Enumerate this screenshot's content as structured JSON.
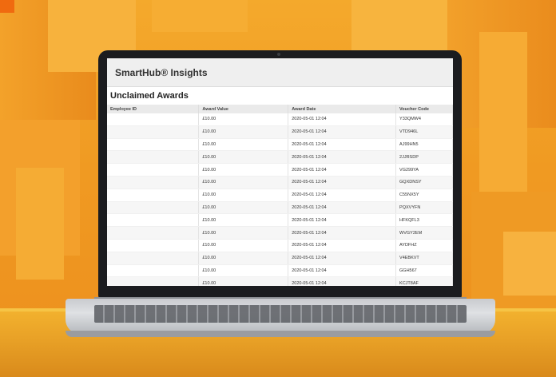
{
  "app": {
    "title": "SmartHub® Insights"
  },
  "section": {
    "title": "Unclaimed Awards"
  },
  "table": {
    "columns": [
      "Employee ID",
      "Award Value",
      "Award Date",
      "Voucher Code"
    ],
    "rows": [
      {
        "employee_id": "",
        "award_value": "£10.00",
        "award_date": "2020-05-01 12:04",
        "voucher_code": "Y33QMW4"
      },
      {
        "employee_id": "",
        "award_value": "£10.00",
        "award_date": "2020-05-01 12:04",
        "voucher_code": "VTD946L"
      },
      {
        "employee_id": "",
        "award_value": "£10.00",
        "award_date": "2020-05-01 12:04",
        "voucher_code": "AJ99HN5"
      },
      {
        "employee_id": "",
        "award_value": "£10.00",
        "award_date": "2020-05-01 12:04",
        "voucher_code": "2JJRSDP"
      },
      {
        "employee_id": "",
        "award_value": "£10.00",
        "award_date": "2020-05-01 12:04",
        "voucher_code": "VG299YA"
      },
      {
        "employee_id": "",
        "award_value": "£10.00",
        "award_date": "2020-05-01 12:04",
        "voucher_code": "GQXDNSY"
      },
      {
        "employee_id": "",
        "award_value": "£10.00",
        "award_date": "2020-05-01 12:04",
        "voucher_code": "C55NX5Y"
      },
      {
        "employee_id": "",
        "award_value": "£10.00",
        "award_date": "2020-05-01 12:04",
        "voucher_code": "PQXVYFN"
      },
      {
        "employee_id": "",
        "award_value": "£10.00",
        "award_date": "2020-05-01 12:04",
        "voucher_code": "HFKQFL3"
      },
      {
        "employee_id": "",
        "award_value": "£10.00",
        "award_date": "2020-05-01 12:04",
        "voucher_code": "WVGY2EM"
      },
      {
        "employee_id": "",
        "award_value": "£10.00",
        "award_date": "2020-05-01 12:04",
        "voucher_code": "AYDFHZ"
      },
      {
        "employee_id": "",
        "award_value": "£10.00",
        "award_date": "2020-05-01 12:04",
        "voucher_code": "V4EBKVT"
      },
      {
        "employee_id": "",
        "award_value": "£10.00",
        "award_date": "2020-05-01 12:04",
        "voucher_code": "GGH567"
      },
      {
        "employee_id": "",
        "award_value": "£10.00",
        "award_date": "2020-05-01 12:04",
        "voucher_code": "KCJT8AF"
      }
    ]
  }
}
